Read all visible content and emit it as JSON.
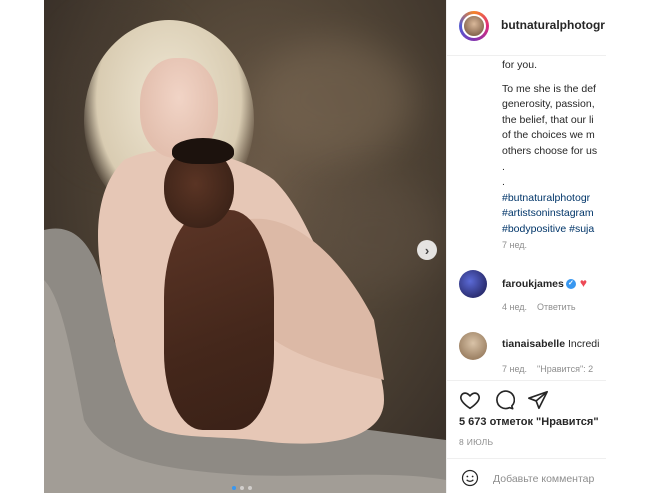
{
  "post": {
    "username": "butnaturalphotogr",
    "caption_lines": [
      "for you.",
      "",
      "To me she is the def",
      "generosity, passion,",
      "the belief, that our li",
      "of the choices we m",
      "others choose for us",
      ".",
      ".",
      "#butnaturalphotogr",
      "#artistsoninstagram",
      "#bodypositive #suja"
    ],
    "caption_time": "7 нед.",
    "image_dots": 3,
    "active_dot": 0
  },
  "comments": [
    {
      "user": "faroukjames",
      "text": "",
      "verified": true,
      "time": "4 нед.",
      "reply": "Ответить",
      "likes": ""
    },
    {
      "user": "tianaisabelle",
      "text": "Incredi",
      "verified": false,
      "time": "7 нед.",
      "reply": "",
      "likes": "\"Нравится\": 2"
    }
  ],
  "actions": {
    "like_icon": "heart-icon",
    "comment_icon": "comment-icon",
    "share_icon": "share-icon",
    "likes_text": "5 673 отметок \"Нравится\"",
    "date": "8 ИЮЛЬ"
  },
  "add_comment": {
    "placeholder": "Добавьте комментар"
  },
  "colors": {
    "link": "#003569",
    "muted": "#8e8e8e",
    "verified": "#3897f0",
    "heart": "#ed4956"
  }
}
